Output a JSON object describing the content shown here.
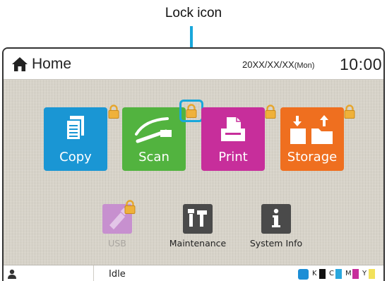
{
  "annotation": {
    "callout_label": "Lock icon"
  },
  "header": {
    "title": "Home",
    "date": "20XX/XX/XX",
    "day": "(Mon)",
    "time": "10:00"
  },
  "main_tiles": [
    {
      "label": "Copy",
      "color": "#1a96d4",
      "locked": true,
      "icon": "copy-icon"
    },
    {
      "label": "Scan",
      "color": "#52b33f",
      "locked": true,
      "icon": "scan-icon"
    },
    {
      "label": "Print",
      "color": "#c72e9b",
      "locked": true,
      "icon": "print-icon"
    },
    {
      "label": "Storage",
      "color": "#ef6f1f",
      "locked": true,
      "icon": "storage-icon"
    }
  ],
  "small_tiles": [
    {
      "label": "USB",
      "disabled": true,
      "locked": true,
      "icon": "usb-icon"
    },
    {
      "label": "Maintenance",
      "icon": "tools-icon"
    },
    {
      "label": "System Info",
      "icon": "info-icon"
    }
  ],
  "status_bar": {
    "status": "Idle",
    "inks": [
      {
        "label": "K",
        "color": "#111111"
      },
      {
        "label": "C",
        "color": "#2aa7de"
      },
      {
        "label": "M",
        "color": "#c72e9b"
      },
      {
        "label": "Y",
        "color": "#f2e15a"
      }
    ]
  }
}
